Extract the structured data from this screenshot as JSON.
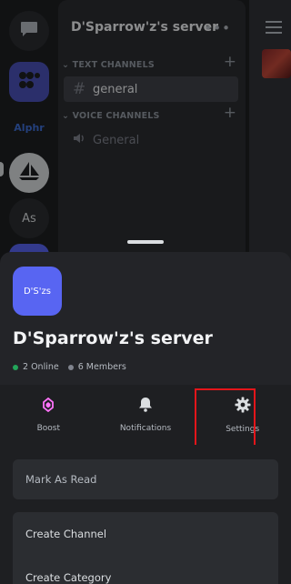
{
  "server": {
    "name": "D'Sparrow'z's server",
    "icon_initials": "D'S'zs"
  },
  "channels": {
    "text_category": "TEXT CHANNELS",
    "voice_category": "VOICE CHANNELS",
    "text_channel": "general",
    "voice_channel": "General"
  },
  "rail": {
    "alphr_label": "Alphr",
    "as_label": "As"
  },
  "stats": {
    "online": "2 Online",
    "members": "6 Members"
  },
  "actions": {
    "boost": "Boost",
    "notifications": "Notifications",
    "settings": "Settings"
  },
  "menu": {
    "mark_as_read": "Mark As Read",
    "create_channel": "Create Channel",
    "create_category": "Create Category"
  },
  "colors": {
    "online": "#23a55a",
    "members": "#80848e",
    "brand": "#5865f2",
    "highlight": "#e3151a"
  }
}
